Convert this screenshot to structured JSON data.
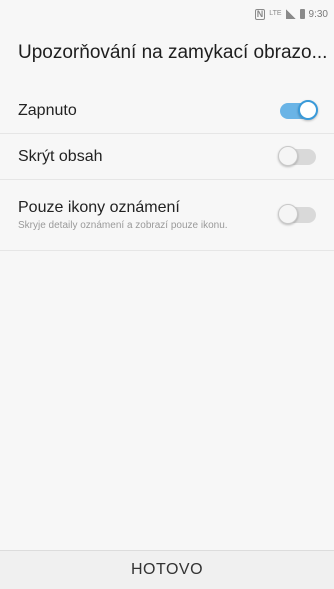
{
  "status_bar": {
    "time": "9:30",
    "nfc_icon": "nfc-icon",
    "network_label": "LTE",
    "signal_icon": "signal-icon",
    "battery_icon": "battery-icon"
  },
  "title": "Upozorňování na zamykací obrazo...",
  "settings": [
    {
      "label": "Zapnuto",
      "subtitle": "",
      "enabled": true
    },
    {
      "label": "Skrýt obsah",
      "subtitle": "",
      "enabled": false
    },
    {
      "label": "Pouze ikony oznámení",
      "subtitle": "Skryje detaily oznámení a zobrazí pouze ikonu.",
      "enabled": false
    }
  ],
  "bottom": {
    "done_label": "HOTOVO"
  },
  "colors": {
    "toggle_on": "#6ab4e6",
    "toggle_knob_border": "#3a9ad9",
    "toggle_off": "#d9d9d9"
  }
}
